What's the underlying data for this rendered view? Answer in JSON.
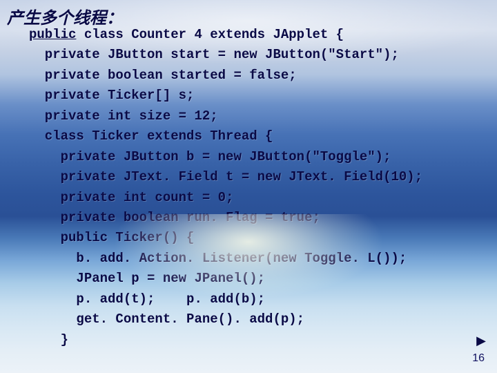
{
  "title": "产生多个线程：",
  "code_lines": [
    "public class Counter 4 extends JApplet {",
    "  private JButton start = new JButton(\"Start\");",
    "  private boolean started = false;",
    "  private Ticker[] s;",
    "  private int size = 12;",
    "  class Ticker extends Thread {",
    "    private JButton b = new JButton(\"Toggle\");",
    "    private JText. Field t = new JText. Field(10);",
    "    private int count = 0;",
    "    private boolean run. Flag = true;",
    "    public Ticker() {",
    "      b. add. Action. Listener(new Toggle. L());",
    "      JPanel p = new JPanel();",
    "      p. add(t);    p. add(b);",
    "      get. Content. Pane(). add(p);",
    "    }"
  ],
  "underline_line_index": 0,
  "underline_start_char": 0,
  "underline_end_char": 6,
  "nav_icon": "▶",
  "page_number": "16"
}
